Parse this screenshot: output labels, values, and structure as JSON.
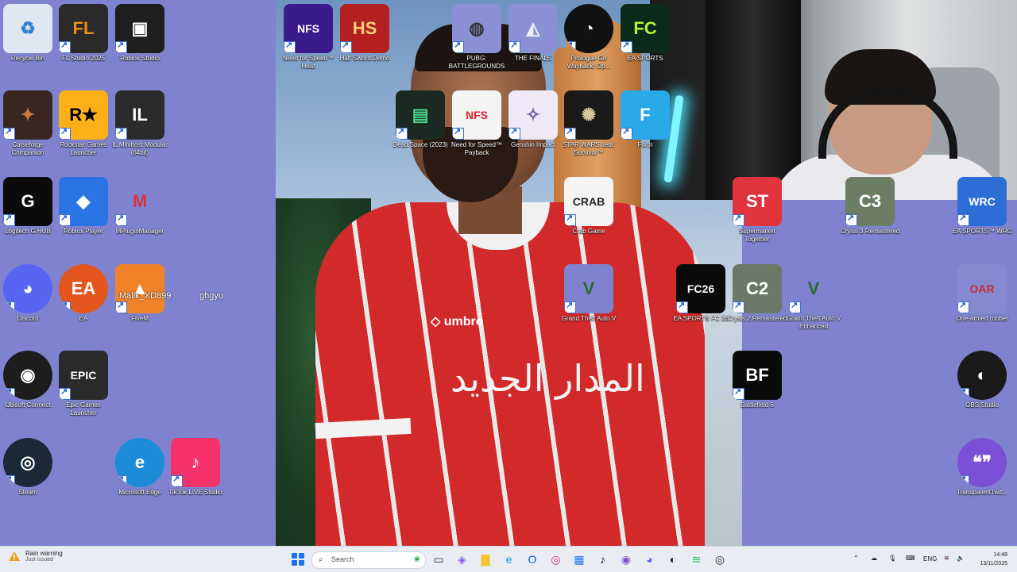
{
  "desktop_icons": [
    {
      "id": "recycle-bin",
      "label": "Recycle Bin",
      "glyph": "♻",
      "bg": "#dfe8f2",
      "fg": "#2f7fd1"
    },
    {
      "id": "fl-studio",
      "label": "FL Studio 2025",
      "glyph": "FL",
      "bg": "#2a2a2a",
      "fg": "#f28a1a"
    },
    {
      "id": "roblox-studio",
      "label": "Roblox Studio",
      "glyph": "▣",
      "bg": "#1e1e1e",
      "fg": "#fff"
    },
    {
      "id": "curseforge",
      "label": "Curseforge Companion",
      "glyph": "✦",
      "bg": "#3a2620",
      "fg": "#d07a3a"
    },
    {
      "id": "rockstar",
      "label": "Rockstar Games Launcher",
      "glyph": "R★",
      "bg": "#fcaf17",
      "fg": "#000"
    },
    {
      "id": "il-minihost",
      "label": "IL Minihost Modular (64bit)",
      "glyph": "IL",
      "bg": "#2b2b2b",
      "fg": "#fff"
    },
    {
      "id": "logitech",
      "label": "Logitech G HUB",
      "glyph": "G",
      "bg": "#0b0b0b",
      "fg": "#fff"
    },
    {
      "id": "roblox-player",
      "label": "Roblox Player",
      "glyph": "◆",
      "bg": "#2b74e6",
      "fg": "#fff"
    },
    {
      "id": "mpluginmanager",
      "label": "MPluginManager",
      "glyph": "M",
      "bg": "#7f83cf",
      "fg": "#d8333a"
    },
    {
      "id": "discord",
      "label": "Discord",
      "glyph": "◕",
      "bg": "#5865f2",
      "fg": "#fff"
    },
    {
      "id": "ea",
      "label": "EA",
      "glyph": "EA",
      "bg": "#e4561e",
      "fg": "#fff"
    },
    {
      "id": "fivem",
      "label": "FiveM",
      "glyph": "▲",
      "bg": "#f0822a",
      "fg": "#fff"
    },
    {
      "id": "ubisoft",
      "label": "Ubisoft Connect",
      "glyph": "◉",
      "bg": "#1d1d1d",
      "fg": "#fff"
    },
    {
      "id": "epic",
      "label": "Epic Games Launcher",
      "glyph": "EPIC",
      "bg": "#2a2a2a",
      "fg": "#fff"
    },
    {
      "id": "steam",
      "label": "Steam",
      "glyph": "◎",
      "bg": "#1b2838",
      "fg": "#fff"
    },
    {
      "id": "edge",
      "label": "Microsoft Edge",
      "glyph": "e",
      "bg": "#1d8cd8",
      "fg": "#fff"
    },
    {
      "id": "tiktok-live",
      "label": "TikTok LIVE Studio",
      "glyph": "♪",
      "bg": "#f5336a",
      "fg": "#fff"
    },
    {
      "id": "nfs-heat",
      "label": "Need for Speed™ Heat",
      "glyph": "NFS",
      "bg": "#3b1a8c",
      "fg": "#fff"
    },
    {
      "id": "half-sword",
      "label": "Half Sword Demo",
      "glyph": "HS",
      "bg": "#b42020",
      "fg": "#f2d07a"
    },
    {
      "id": "pubg",
      "label": "PUBG: BATTLEGROUNDS",
      "glyph": "◍",
      "bg": "#8b8fd4",
      "fg": "#333"
    },
    {
      "id": "the-finals",
      "label": "THE FINALS",
      "glyph": "◭",
      "bg": "#8b8fd4",
      "fg": "#eee"
    },
    {
      "id": "prologue",
      "label": "Prologue Go Wayback! Op...",
      "glyph": "◔",
      "bg": "#111",
      "fg": "#fff"
    },
    {
      "id": "ea-sports-fc",
      "label": "EA SPORTS",
      "glyph": "FC",
      "bg": "#0c2a1a",
      "fg": "#b6f23a"
    },
    {
      "id": "dead-space",
      "label": "Dead Space (2023)",
      "glyph": "▤",
      "bg": "#1a2a22",
      "fg": "#49d68a"
    },
    {
      "id": "nfs-payback",
      "label": "Need for Speed™ Payback",
      "glyph": "NFS",
      "bg": "#f4f4f4",
      "fg": "#e0202a"
    },
    {
      "id": "genshin",
      "label": "Genshin Impact",
      "glyph": "✧",
      "bg": "#efe8f6",
      "fg": "#6a5aa8"
    },
    {
      "id": "star-wars",
      "label": "STAR WARS Jedi: Survivor™",
      "glyph": "✺",
      "bg": "#1a1a1a",
      "fg": "#d8c79a"
    },
    {
      "id": "fortnite",
      "label": "Fortn",
      "glyph": "F",
      "bg": "#2aa9e8",
      "fg": "#fff"
    },
    {
      "id": "crab-game",
      "label": "Crab Game",
      "glyph": "CRAB",
      "bg": "#f4f4f4",
      "fg": "#222"
    },
    {
      "id": "supermarket",
      "label": "Supermarket Together",
      "glyph": "ST",
      "bg": "#e2343c",
      "fg": "#fff"
    },
    {
      "id": "crysis3",
      "label": "Crysis 3 Remastered",
      "glyph": "C3",
      "bg": "#6b7d62",
      "fg": "#fff"
    },
    {
      "id": "ea-wrc",
      "label": "EA SPORTS™ WRC",
      "glyph": "WRC",
      "bg": "#2c6ed6",
      "fg": "#fff"
    },
    {
      "id": "gta5",
      "label": "Grand Theft Auto V",
      "glyph": "V",
      "bg": "#7f83cf",
      "fg": "#2e6a2a"
    },
    {
      "id": "fc26",
      "label": "EA SPORTS FC 26",
      "glyph": "FC26",
      "bg": "#0b0b0b",
      "fg": "#fff"
    },
    {
      "id": "crysis2",
      "label": "Crysis 2 Remastered",
      "glyph": "C2",
      "bg": "#6a7a66",
      "fg": "#fff"
    },
    {
      "id": "gta5-enhanced",
      "label": "Grand Theft Auto V Enhanced",
      "glyph": "V",
      "bg": "#7f83cf",
      "fg": "#2e6a2a"
    },
    {
      "id": "one-armed-robber",
      "label": "One-armed robber",
      "glyph": "OAR",
      "bg": "#8589d2",
      "fg": "#c23030"
    },
    {
      "id": "battlefield6",
      "label": "Battlefield 6",
      "glyph": "BF",
      "bg": "#0a0a0a",
      "fg": "#fff"
    },
    {
      "id": "obs",
      "label": "OBS Studio",
      "glyph": "◐",
      "bg": "#1a1a1a",
      "fg": "#fff"
    },
    {
      "id": "transparent-twitch",
      "label": "TransparentTwit...",
      "glyph": "❝❞",
      "bg": "#7b4fd6",
      "fg": "#fff"
    }
  ],
  "overlay_text": {
    "username": "Malik_XD899",
    "extra": "ghgyu"
  },
  "taskbar": {
    "weather_title": "Rain warning",
    "weather_sub": "Just issued",
    "search_placeholder": "Search",
    "tray_lang": "ENG",
    "time": "14:48",
    "date": "13/11/2025",
    "apps": [
      {
        "id": "task-view",
        "glyph": "▭",
        "color": "#333"
      },
      {
        "id": "copilot",
        "glyph": "◈",
        "color": "#8a5cf5"
      },
      {
        "id": "file-explorer",
        "glyph": "▇",
        "color": "#f4c430"
      },
      {
        "id": "edge",
        "glyph": "e",
        "color": "#1d8cd8"
      },
      {
        "id": "outlook",
        "glyph": "O",
        "color": "#0a64c8"
      },
      {
        "id": "instagram",
        "glyph": "◎",
        "color": "#d6306a"
      },
      {
        "id": "store",
        "glyph": "▦",
        "color": "#1a73e8"
      },
      {
        "id": "tiktok",
        "glyph": "♪",
        "color": "#111"
      },
      {
        "id": "app-purple",
        "glyph": "◉",
        "color": "#7a52c4"
      },
      {
        "id": "discord",
        "glyph": "◕",
        "color": "#5865f2"
      },
      {
        "id": "obs",
        "glyph": "◐",
        "color": "#222"
      },
      {
        "id": "spotify",
        "glyph": "≋",
        "color": "#1db954"
      },
      {
        "id": "steam",
        "glyph": "◎",
        "color": "#1b2838"
      }
    ]
  }
}
